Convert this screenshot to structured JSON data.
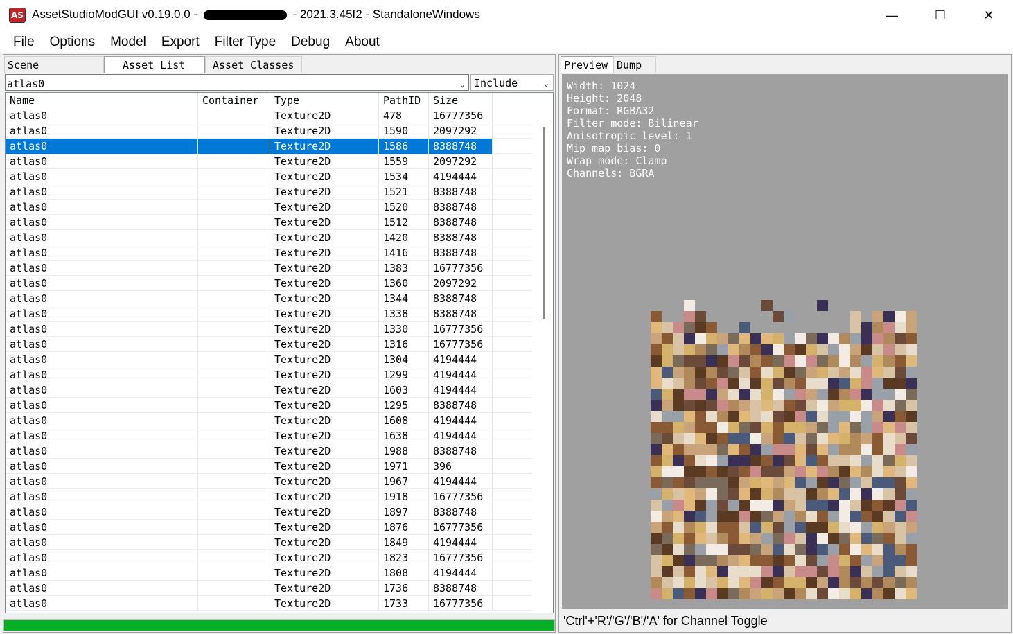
{
  "window": {
    "title_prefix": "AssetStudioModGUI v0.19.0.0 -",
    "title_suffix": "- 2021.3.45f2 - StandaloneWindows",
    "icon_text": "AS",
    "minimize": "—",
    "maximize": "☐",
    "close": "✕"
  },
  "menu": [
    "File",
    "Options",
    "Model",
    "Export",
    "Filter Type",
    "Debug",
    "About"
  ],
  "left_tabs": [
    "Scene Hierarchy",
    "Asset List",
    "Asset Classes"
  ],
  "filter": {
    "search_value": "atlas0",
    "include_value": "Include"
  },
  "columns": [
    "Name",
    "Container",
    "Type",
    "PathID",
    "Size"
  ],
  "rows": [
    {
      "name": "atlas0",
      "container": "",
      "type": "Texture2D",
      "path_id": "478",
      "size": "16777356"
    },
    {
      "name": "atlas0",
      "container": "",
      "type": "Texture2D",
      "path_id": "1590",
      "size": "2097292"
    },
    {
      "name": "atlas0",
      "container": "",
      "type": "Texture2D",
      "path_id": "1586",
      "size": "8388748"
    },
    {
      "name": "atlas0",
      "container": "",
      "type": "Texture2D",
      "path_id": "1559",
      "size": "2097292"
    },
    {
      "name": "atlas0",
      "container": "",
      "type": "Texture2D",
      "path_id": "1534",
      "size": "4194444"
    },
    {
      "name": "atlas0",
      "container": "",
      "type": "Texture2D",
      "path_id": "1521",
      "size": "8388748"
    },
    {
      "name": "atlas0",
      "container": "",
      "type": "Texture2D",
      "path_id": "1520",
      "size": "8388748"
    },
    {
      "name": "atlas0",
      "container": "",
      "type": "Texture2D",
      "path_id": "1512",
      "size": "8388748"
    },
    {
      "name": "atlas0",
      "container": "",
      "type": "Texture2D",
      "path_id": "1420",
      "size": "8388748"
    },
    {
      "name": "atlas0",
      "container": "",
      "type": "Texture2D",
      "path_id": "1416",
      "size": "8388748"
    },
    {
      "name": "atlas0",
      "container": "",
      "type": "Texture2D",
      "path_id": "1383",
      "size": "16777356"
    },
    {
      "name": "atlas0",
      "container": "",
      "type": "Texture2D",
      "path_id": "1360",
      "size": "2097292"
    },
    {
      "name": "atlas0",
      "container": "",
      "type": "Texture2D",
      "path_id": "1344",
      "size": "8388748"
    },
    {
      "name": "atlas0",
      "container": "",
      "type": "Texture2D",
      "path_id": "1338",
      "size": "8388748"
    },
    {
      "name": "atlas0",
      "container": "",
      "type": "Texture2D",
      "path_id": "1330",
      "size": "16777356"
    },
    {
      "name": "atlas0",
      "container": "",
      "type": "Texture2D",
      "path_id": "1316",
      "size": "16777356"
    },
    {
      "name": "atlas0",
      "container": "",
      "type": "Texture2D",
      "path_id": "1304",
      "size": "4194444"
    },
    {
      "name": "atlas0",
      "container": "",
      "type": "Texture2D",
      "path_id": "1299",
      "size": "4194444"
    },
    {
      "name": "atlas0",
      "container": "",
      "type": "Texture2D",
      "path_id": "1603",
      "size": "4194444"
    },
    {
      "name": "atlas0",
      "container": "",
      "type": "Texture2D",
      "path_id": "1295",
      "size": "8388748"
    },
    {
      "name": "atlas0",
      "container": "",
      "type": "Texture2D",
      "path_id": "1608",
      "size": "4194444"
    },
    {
      "name": "atlas0",
      "container": "",
      "type": "Texture2D",
      "path_id": "1638",
      "size": "4194444"
    },
    {
      "name": "atlas0",
      "container": "",
      "type": "Texture2D",
      "path_id": "1988",
      "size": "8388748"
    },
    {
      "name": "atlas0",
      "container": "",
      "type": "Texture2D",
      "path_id": "1971",
      "size": "396"
    },
    {
      "name": "atlas0",
      "container": "",
      "type": "Texture2D",
      "path_id": "1967",
      "size": "4194444"
    },
    {
      "name": "atlas0",
      "container": "",
      "type": "Texture2D",
      "path_id": "1918",
      "size": "16777356"
    },
    {
      "name": "atlas0",
      "container": "",
      "type": "Texture2D",
      "path_id": "1897",
      "size": "8388748"
    },
    {
      "name": "atlas0",
      "container": "",
      "type": "Texture2D",
      "path_id": "1876",
      "size": "16777356"
    },
    {
      "name": "atlas0",
      "container": "",
      "type": "Texture2D",
      "path_id": "1849",
      "size": "4194444"
    },
    {
      "name": "atlas0",
      "container": "",
      "type": "Texture2D",
      "path_id": "1823",
      "size": "16777356"
    },
    {
      "name": "atlas0",
      "container": "",
      "type": "Texture2D",
      "path_id": "1808",
      "size": "4194444"
    },
    {
      "name": "atlas0",
      "container": "",
      "type": "Texture2D",
      "path_id": "1736",
      "size": "8388748"
    },
    {
      "name": "atlas0",
      "container": "",
      "type": "Texture2D",
      "path_id": "1733",
      "size": "16777356"
    }
  ],
  "selected_row_index": 2,
  "right_tabs": [
    "Preview",
    "Dump"
  ],
  "preview_info": [
    "Width: 1024",
    "Height: 2048",
    "Format: RGBA32",
    "Filter mode: Bilinear",
    "Anisotropic level: 1",
    "Mip map bias: 0",
    "Wrap mode: Clamp",
    "Channels: BGRA"
  ],
  "status_bar": "'Ctrl'+'R'/'G'/'B'/'A' for Channel Toggle",
  "progress_fraction": 1.0,
  "colors": {
    "selection": "#0078d7",
    "progress": "#06b025",
    "preview_bg": "#a0a0a0"
  }
}
